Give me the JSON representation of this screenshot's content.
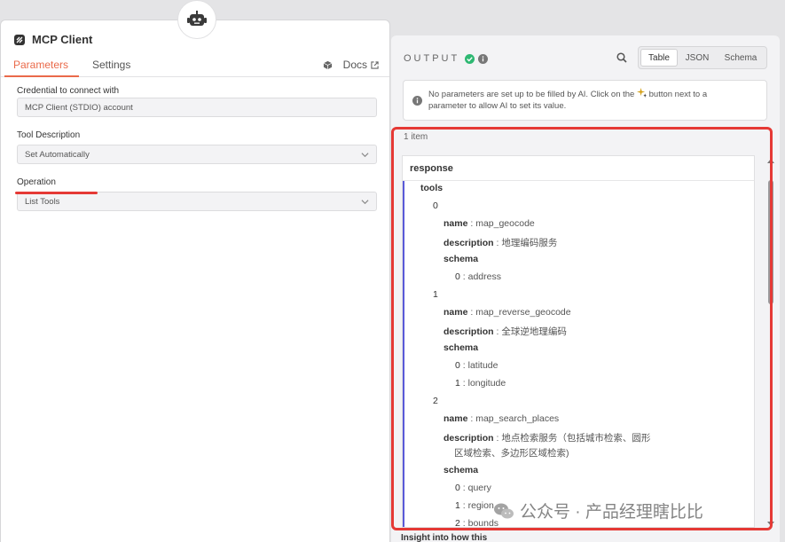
{
  "node": {
    "title": "MCP Client",
    "tabs": [
      "Parameters",
      "Settings"
    ],
    "docs_label": "Docs"
  },
  "params": {
    "credential_label": "Credential to connect with",
    "credential_value": "MCP Client (STDIO) account",
    "tool_desc_label": "Tool Description",
    "tool_desc_value": "Set Automatically",
    "operation_label": "Operation",
    "operation_value": "List Tools"
  },
  "output": {
    "label": "OUTPUT",
    "views": [
      "Table",
      "JSON",
      "Schema"
    ],
    "active_view": "Table",
    "notice_part1": "No parameters are set up to be filled by AI. Click on the",
    "notice_part2": "button next to a",
    "notice_line2": "parameter to allow AI to set its value.",
    "item_count": "1 item",
    "tree_header": "response",
    "rows": [
      {
        "indent": 1,
        "key": "tools",
        "value": ""
      },
      {
        "indent": 2,
        "key": "0",
        "value": ""
      },
      {
        "indent": 3,
        "key": "name",
        "value": "map_geocode"
      },
      {
        "indent": 3,
        "key": "description",
        "value": "地理编码服务"
      },
      {
        "indent": 3,
        "key": "schema",
        "value": ""
      },
      {
        "indent": 4,
        "key": "0",
        "value": "address"
      },
      {
        "indent": 2,
        "key": "1",
        "value": ""
      },
      {
        "indent": 3,
        "key": "name",
        "value": "map_reverse_geocode"
      },
      {
        "indent": 3,
        "key": "description",
        "value": "全球逆地理编码"
      },
      {
        "indent": 3,
        "key": "schema",
        "value": ""
      },
      {
        "indent": 4,
        "key": "0",
        "value": "latitude"
      },
      {
        "indent": 4,
        "key": "1",
        "value": "longitude"
      },
      {
        "indent": 2,
        "key": "2",
        "value": ""
      },
      {
        "indent": 3,
        "key": "name",
        "value": "map_search_places"
      },
      {
        "indent": 3,
        "key": "description",
        "value": "地点检索服务（包括城市检索、圆形",
        "value2": "区域检索、多边形区域检索)"
      },
      {
        "indent": 3,
        "key": "schema",
        "value": ""
      },
      {
        "indent": 4,
        "key": "0",
        "value": "query"
      },
      {
        "indent": 4,
        "key": "1",
        "value": "region"
      },
      {
        "indent": 4,
        "key": "2",
        "value": "bounds"
      }
    ],
    "bottom_fragment": "Insight into how this"
  },
  "watermark": "公众号 · 产品经理瞎比比",
  "colors": {
    "accent": "#ea6a4a",
    "highlight": "#e53935",
    "success": "#2eb872",
    "tree_line": "#5a5ad8"
  }
}
